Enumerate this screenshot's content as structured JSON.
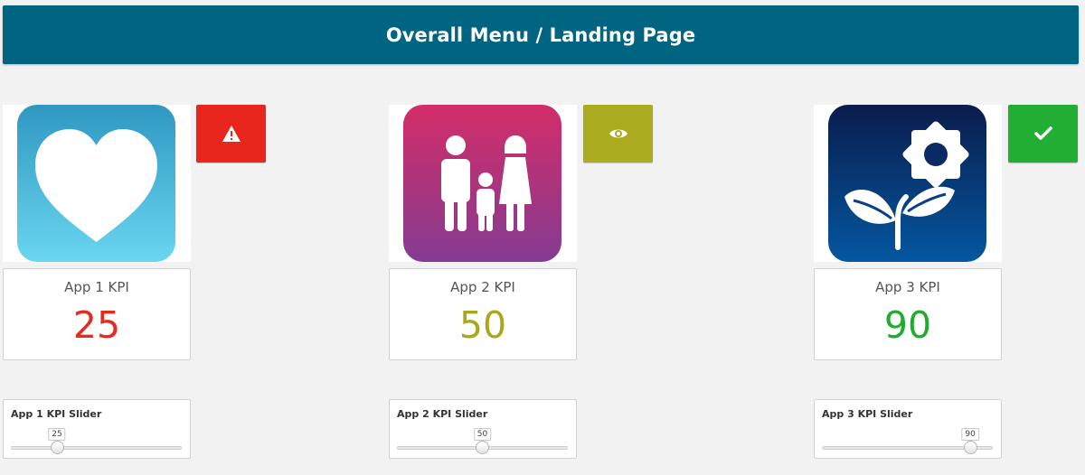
{
  "header": {
    "title": "Overall Menu / Landing Page"
  },
  "apps": [
    {
      "icon": "heart-icon",
      "status": {
        "icon": "warning-icon",
        "color": "#e8261e"
      },
      "kpi": {
        "label": "App 1 KPI",
        "value": "25",
        "color": "#e32b22"
      },
      "slider": {
        "title": "App 1 KPI Slider",
        "value": 25,
        "display": "25",
        "min": 0,
        "max": 100
      }
    },
    {
      "icon": "family-icon",
      "status": {
        "icon": "eye-icon",
        "color": "#abab1f"
      },
      "kpi": {
        "label": "App 2 KPI",
        "value": "50",
        "color": "#a9a81d"
      },
      "slider": {
        "title": "App 2 KPI Slider",
        "value": 50,
        "display": "50",
        "min": 0,
        "max": 100
      }
    },
    {
      "icon": "plant-sun-icon",
      "status": {
        "icon": "checkmark-icon",
        "color": "#22ad33"
      },
      "kpi": {
        "label": "App 3 KPI",
        "value": "90",
        "color": "#22ac2f"
      },
      "slider": {
        "title": "App 3 KPI Slider",
        "value": 90,
        "display": "90",
        "min": 0,
        "max": 100
      }
    }
  ]
}
